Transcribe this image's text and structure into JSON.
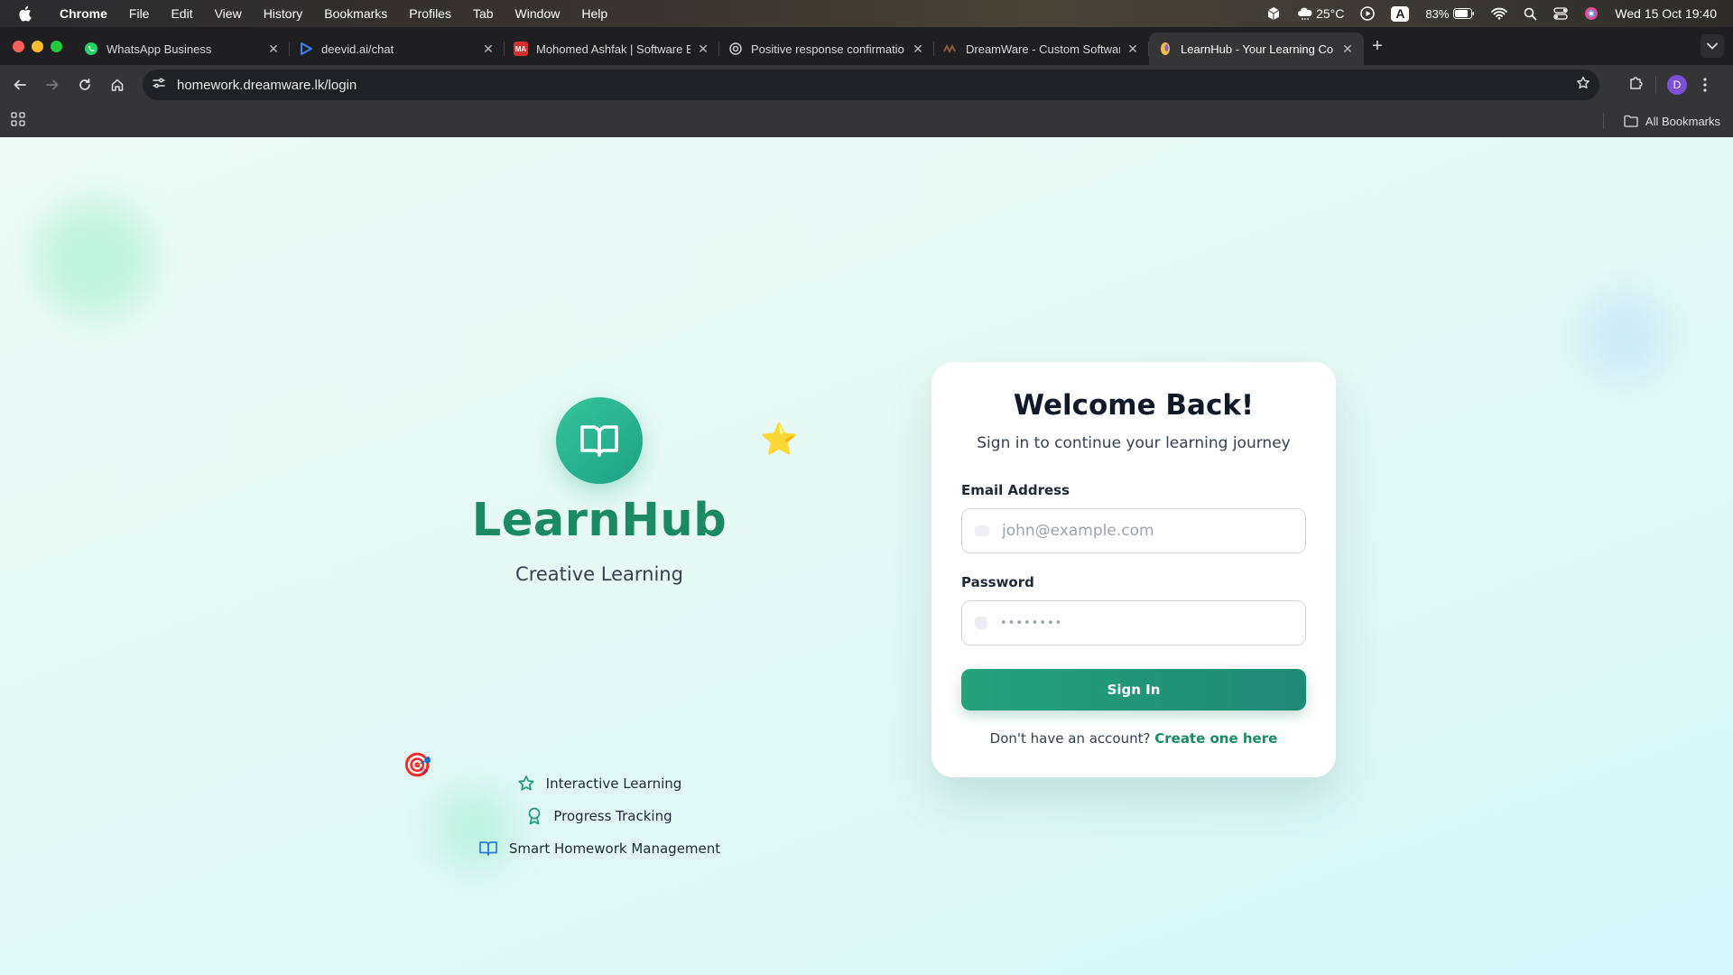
{
  "menubar": {
    "app_name": "Chrome",
    "items": [
      "File",
      "Edit",
      "View",
      "History",
      "Bookmarks",
      "Profiles",
      "Tab",
      "Window",
      "Help"
    ],
    "weather": "25°C",
    "input_source": "A",
    "battery": "83%",
    "datetime": "Wed 15 Oct  19:40"
  },
  "tabs": [
    {
      "title": "WhatsApp Business",
      "icon": "whatsapp-icon",
      "color": "#25d366"
    },
    {
      "title": "deevid.ai/chat",
      "icon": "deevid-icon",
      "color": "#3b82f6"
    },
    {
      "title": "Mohomed Ashfak | Software E",
      "icon": "ma-icon",
      "color": "#d32f2f"
    },
    {
      "title": "Positive response confirmatio",
      "icon": "openai-icon",
      "color": "#cfcfcf"
    },
    {
      "title": "DreamWare - Custom Softwar",
      "icon": "dreamware-icon",
      "color": "#8a5a44"
    },
    {
      "title": "LearnHub - Your Learning Co",
      "icon": "learnhub-icon",
      "color": "#f5b942",
      "active": true
    }
  ],
  "toolbar": {
    "url": "homework.dreamware.lk/login",
    "profile_initial": "D"
  },
  "bookmarks": {
    "all_bookmarks_label": "All Bookmarks"
  },
  "brand": {
    "name": "LearnHub",
    "tagline": "Creative Learning",
    "accent": "#1b8a63",
    "decor_star": "⭐",
    "decor_dart": "🎯"
  },
  "features": [
    {
      "label": "Interactive Learning",
      "icon": "star-outline-icon"
    },
    {
      "label": "Progress Tracking",
      "icon": "award-icon"
    },
    {
      "label": "Smart Homework Management",
      "icon": "open-book-icon"
    }
  ],
  "login": {
    "title": "Welcome Back!",
    "subtitle": "Sign in to continue your learning journey",
    "email_label": "Email Address",
    "email_placeholder": "john@example.com",
    "password_label": "Password",
    "password_placeholder": "••••••••",
    "submit_label": "Sign In",
    "signup_prompt": "Don't have an account?",
    "signup_link": "Create one here"
  }
}
